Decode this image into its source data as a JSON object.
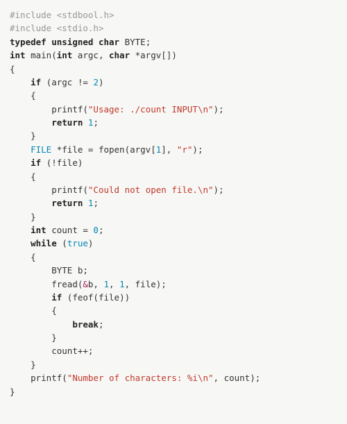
{
  "code": {
    "inc1": "#include <stdbool.h>",
    "inc2": "#include <stdio.h>",
    "kw_typedef": "typedef",
    "kw_unsigned": "unsigned",
    "kw_char": "char",
    "byte": " BYTE;",
    "kw_int": "int",
    "main": " main(",
    "argc": " argc, ",
    "argv": " *argv[])",
    "brace_open": "{",
    "indent1": "    ",
    "indent2": "        ",
    "indent3": "            ",
    "kw_if": "if",
    "cond_argc": " (argc != ",
    "num_2": "2",
    "paren_close": ")",
    "printf": "printf(",
    "str_usage": "\"Usage: ./count INPUT\\n\"",
    "close_stmt": ");",
    "kw_return": "return",
    "sp": " ",
    "num_1": "1",
    "semi": ";",
    "brace_close": "}",
    "type_FILE": "FILE",
    "file_decl": " *file = fopen(argv[",
    "bracket_close": "], ",
    "str_r": "\"r\"",
    "cond_file": " (!file)",
    "str_noopen": "\"Could not open file.\\n\"",
    "count_decl": " count = ",
    "num_0": "0",
    "kw_while": "while",
    "sp_paren": " (",
    "lit_true": "true",
    "byte_b": "BYTE b;",
    "fread": "fread(",
    "amp": "&",
    "fread_tail": "b, ",
    "comma_sp": ", ",
    "fread_end": ", file);",
    "feof": " (feof(file))",
    "kw_break": "break",
    "count_inc": "count++;",
    "str_num": "\"Number of characters: %i\\n\"",
    "printf_tail": ", count);"
  }
}
